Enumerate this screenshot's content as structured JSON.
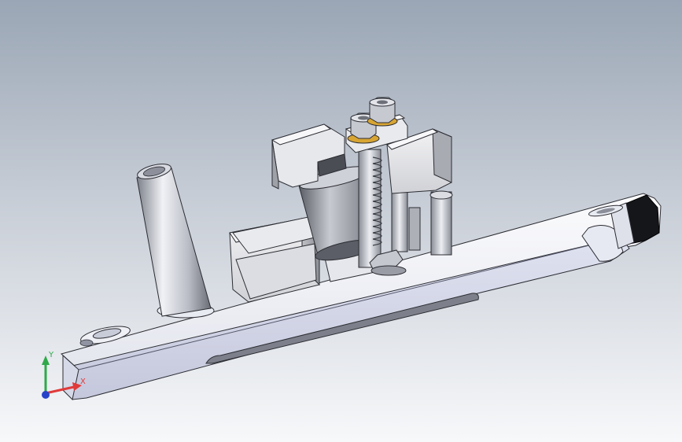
{
  "triad": {
    "x_label": "X",
    "y_label": "Y",
    "x_color": "#e03a3a",
    "y_color": "#2fa84a",
    "z_color": "#2742c9"
  },
  "colors": {
    "background_top": "#9aa6b5",
    "background_bottom": "#f7f8fa",
    "plate_top": "#f2f3f8",
    "plate_side": "#dfe2ef",
    "plate_front": "#c9cce0",
    "steel": "#b9bcc6",
    "dark_block": "#1a1b20",
    "brass": "#d8a533"
  }
}
